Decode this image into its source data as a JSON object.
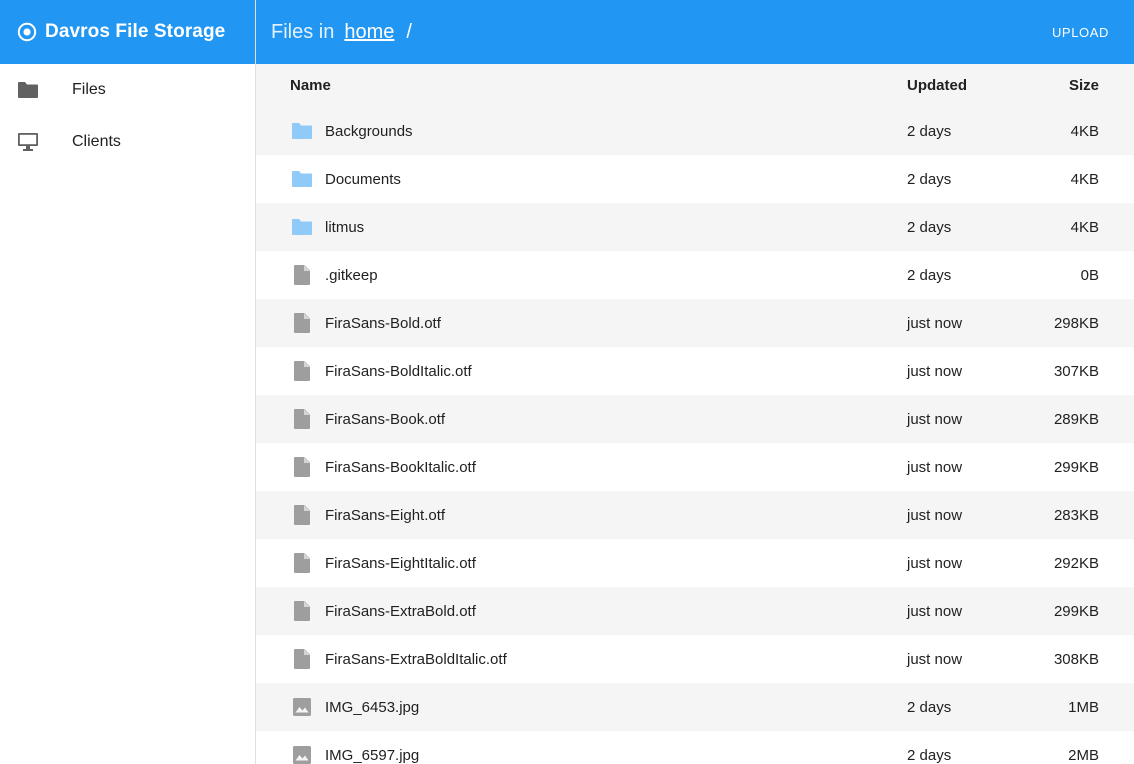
{
  "app": {
    "title": "Davros File Storage",
    "accent_color": "#2196f3"
  },
  "sidebar": {
    "items": [
      {
        "label": "Files",
        "icon": "folder-icon"
      },
      {
        "label": "Clients",
        "icon": "monitor-icon"
      }
    ]
  },
  "toolbar": {
    "prefix": "Files in",
    "crumb": "home",
    "separator": "/",
    "upload_label": "UPLOAD"
  },
  "table": {
    "columns": {
      "name": "Name",
      "updated": "Updated",
      "size": "Size"
    },
    "rows": [
      {
        "type": "folder",
        "icon": "folder-icon",
        "name": "Backgrounds",
        "updated": "2 days",
        "size": "4KB"
      },
      {
        "type": "folder",
        "icon": "folder-icon",
        "name": "Documents",
        "updated": "2 days",
        "size": "4KB"
      },
      {
        "type": "folder",
        "icon": "folder-icon",
        "name": "litmus",
        "updated": "2 days",
        "size": "4KB"
      },
      {
        "type": "file",
        "icon": "file-icon",
        "name": ".gitkeep",
        "updated": "2 days",
        "size": "0B"
      },
      {
        "type": "file",
        "icon": "file-icon",
        "name": "FiraSans-Bold.otf",
        "updated": "just now",
        "size": "298KB"
      },
      {
        "type": "file",
        "icon": "file-icon",
        "name": "FiraSans-BoldItalic.otf",
        "updated": "just now",
        "size": "307KB"
      },
      {
        "type": "file",
        "icon": "file-icon",
        "name": "FiraSans-Book.otf",
        "updated": "just now",
        "size": "289KB"
      },
      {
        "type": "file",
        "icon": "file-icon",
        "name": "FiraSans-BookItalic.otf",
        "updated": "just now",
        "size": "299KB"
      },
      {
        "type": "file",
        "icon": "file-icon",
        "name": "FiraSans-Eight.otf",
        "updated": "just now",
        "size": "283KB"
      },
      {
        "type": "file",
        "icon": "file-icon",
        "name": "FiraSans-EightItalic.otf",
        "updated": "just now",
        "size": "292KB"
      },
      {
        "type": "file",
        "icon": "file-icon",
        "name": "FiraSans-ExtraBold.otf",
        "updated": "just now",
        "size": "299KB"
      },
      {
        "type": "file",
        "icon": "file-icon",
        "name": "FiraSans-ExtraBoldItalic.otf",
        "updated": "just now",
        "size": "308KB"
      },
      {
        "type": "image",
        "icon": "image-icon",
        "name": "IMG_6453.jpg",
        "updated": "2 days",
        "size": "1MB"
      },
      {
        "type": "image",
        "icon": "image-icon",
        "name": "IMG_6597.jpg",
        "updated": "2 days",
        "size": "2MB"
      }
    ]
  }
}
